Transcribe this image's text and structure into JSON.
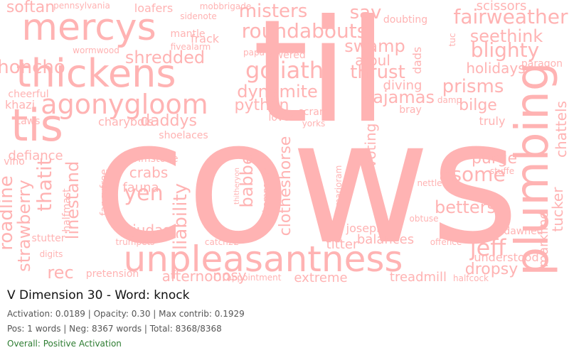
{
  "title": "V Dimension 30 - Word: knock",
  "stats_line": "Activation: 0.0189 | Opacity: 0.30 | Max contrib: 0.1929",
  "counts_line": "Pos: 1 words | Neg: 8367 words | Total: 8368/8368",
  "overall_line": "Overall: Positive Activation",
  "colors": {
    "word": "#ffb3b3",
    "overall": "#2e7d32"
  },
  "cloud_words": [
    "cows",
    "til",
    "unpleasantness",
    "plumbing",
    "thickens",
    "tis",
    "mercys",
    "agonygloom",
    "fairweather",
    "roundabouts",
    "goliath",
    "misters",
    "shredded",
    "seethink",
    "blighty",
    "dynamite",
    "prisms",
    "roadline",
    "strawberry",
    "thatit",
    "linestand",
    "yen",
    "asome",
    "betters",
    "jeff",
    "dropsy",
    "babber",
    "liability",
    "clotheshorse",
    "python",
    "daddys",
    "honcho",
    "softan",
    "crabs",
    "fauna",
    "judas",
    "afternoon",
    "nosy",
    "extreme",
    "balances",
    "treadmill",
    "swamp",
    "afoul",
    "thrust",
    "sav",
    "pajamas",
    "voting",
    "diving",
    "bilge",
    "holidays",
    "purge",
    "chattels",
    "tucker",
    "markline",
    "dawned",
    "understood",
    "titter",
    "joseph",
    "rec",
    "defiance",
    "vino",
    "taws",
    "khazi",
    "cheerful",
    "charybdis",
    "shoelaces",
    "brimstone",
    "fancyfree",
    "halfmast",
    "stutter",
    "digits",
    "pretension",
    "trumpets",
    "appointment",
    "catch22",
    "nettle",
    "obtuse",
    "offence",
    "halfcock",
    "scram",
    "lover",
    "lowered",
    "yorks",
    "frack",
    "mantle",
    "loafers",
    "fivealarm",
    "wormwood",
    "pennsylvania",
    "scissors",
    "paragon",
    "truly",
    "stuffe",
    "sidenote",
    "mobbrigade",
    "dads",
    "bray",
    "papa",
    "champagne",
    "thitheryon",
    "marjoram",
    "doubting",
    "damp",
    "tuc"
  ]
}
